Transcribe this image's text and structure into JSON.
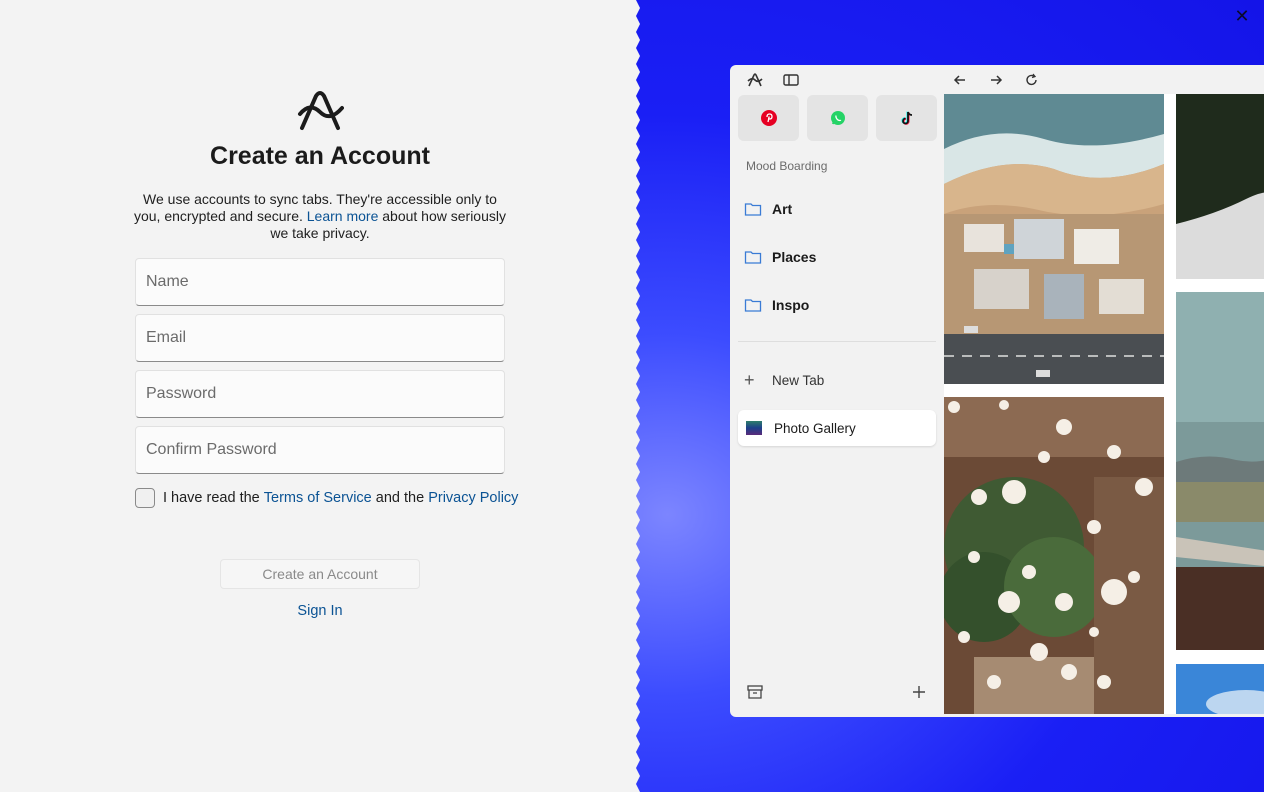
{
  "signup": {
    "title": "Create an Account",
    "desc_part1": "We use accounts to sync tabs. They're accessible only to you, encrypted and secure. ",
    "learn_more": "Learn more",
    "desc_part2": " about how seriously we take privacy.",
    "fields": {
      "name_placeholder": "Name",
      "email_placeholder": "Email",
      "password_placeholder": "Password",
      "confirm_placeholder": "Confirm Password"
    },
    "terms_prefix": "I have read the ",
    "terms_link": "Terms of Service",
    "terms_mid": " and the ",
    "privacy_link": "Privacy Policy",
    "create_button": "Create an Account",
    "sign_in": "Sign In"
  },
  "preview": {
    "section_label": "Mood Boarding",
    "folders": [
      "Art",
      "Places",
      "Inspo"
    ],
    "new_tab": "New Tab",
    "active_tab": "Photo Gallery",
    "pinned": [
      "pinterest-icon",
      "whatsapp-icon",
      "tiktok-icon"
    ]
  },
  "colors": {
    "accent_link": "#0b5394",
    "backdrop_blue": "#1a1ff5",
    "folder_blue": "#3a7bd5"
  }
}
